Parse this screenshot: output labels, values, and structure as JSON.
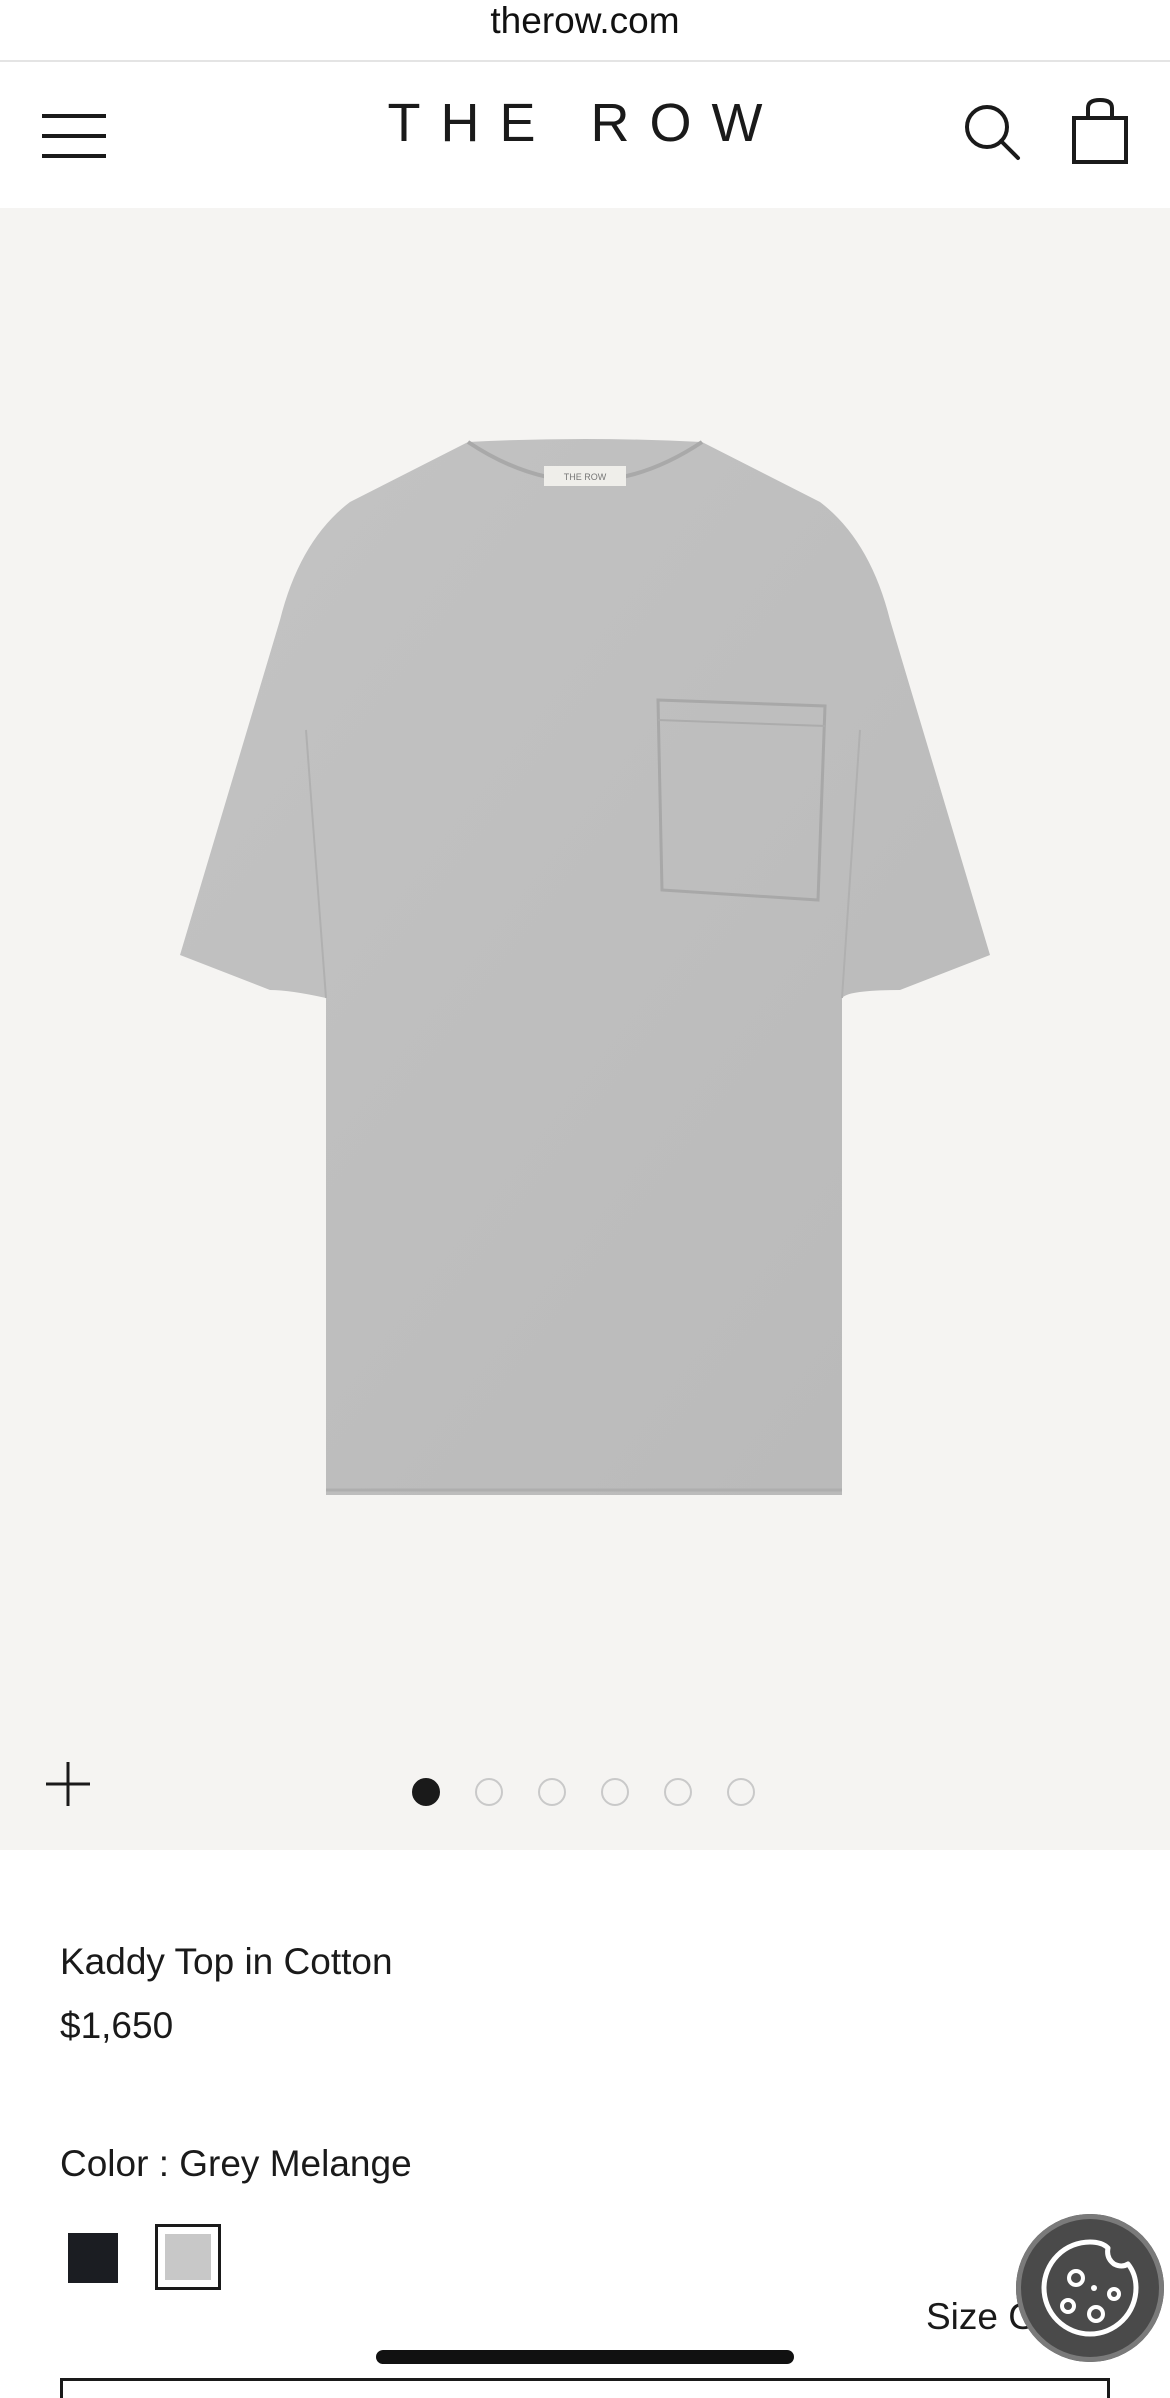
{
  "browser": {
    "url": "therow.com"
  },
  "header": {
    "logo": "THE ROW",
    "menu_icon": "hamburger-menu-icon",
    "search_icon": "search-icon",
    "bag_icon": "shopping-bag-icon"
  },
  "gallery": {
    "image_alt": "Kaddy Top in Cotton - Grey Melange",
    "label_text": "THE ROW",
    "zoom_icon": "plus-icon",
    "total_images": 6,
    "current_image": 1
  },
  "product": {
    "title": "Kaddy Top in Cotton",
    "price": "$1,650",
    "color_label": "Color : Grey Melange",
    "swatches": [
      {
        "name": "Black",
        "color": "#1b1d22",
        "selected": false
      },
      {
        "name": "Grey Melange",
        "color": "#c8c8c8",
        "selected": true
      }
    ],
    "size_guide": "Size Guide"
  },
  "cookie_button": {
    "icon": "cookie-icon"
  },
  "colors": {
    "gallery_bg": "#f5f4f2",
    "text": "#1a1a1a",
    "tee": "#bdbdbd"
  }
}
